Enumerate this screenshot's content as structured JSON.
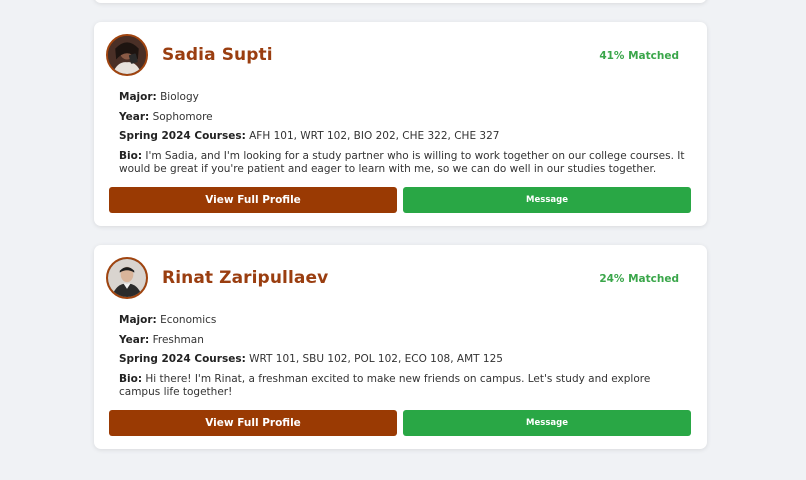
{
  "profiles": [
    {
      "name": "Sadia Supti",
      "match": "41% Matched",
      "major_label": "Major:",
      "major": "Biology",
      "year_label": "Year:",
      "year": "Sophomore",
      "courses_label": "Spring 2024 Courses:",
      "courses": "AFH 101, WRT 102, BIO 202, CHE 322, CHE 327",
      "bio_label": "Bio:",
      "bio": "I'm Sadia, and I'm looking for a study partner who is willing to work together on our college courses. It would be great if you're patient and eager to learn with me, so we can do well in our studies together.",
      "view_profile_label": "View Full Profile",
      "message_label": "Message"
    },
    {
      "name": "Rinat Zaripullaev",
      "match": "24% Matched",
      "major_label": "Major:",
      "major": "Economics",
      "year_label": "Year:",
      "year": "Freshman",
      "courses_label": "Spring 2024 Courses:",
      "courses": "WRT 101, SBU 102, POL 102, ECO 108, AMT 125",
      "bio_label": "Bio:",
      "bio": "Hi there! I'm Rinat, a freshman excited to make new friends on campus. Let's study and explore campus life together!",
      "view_profile_label": "View Full Profile",
      "message_label": "Message"
    }
  ],
  "colors": {
    "accent": "#9a3a03",
    "name": "#9a3e10",
    "match": "#3aa64a",
    "message_button": "#29a745",
    "background": "#f0f2f5"
  }
}
